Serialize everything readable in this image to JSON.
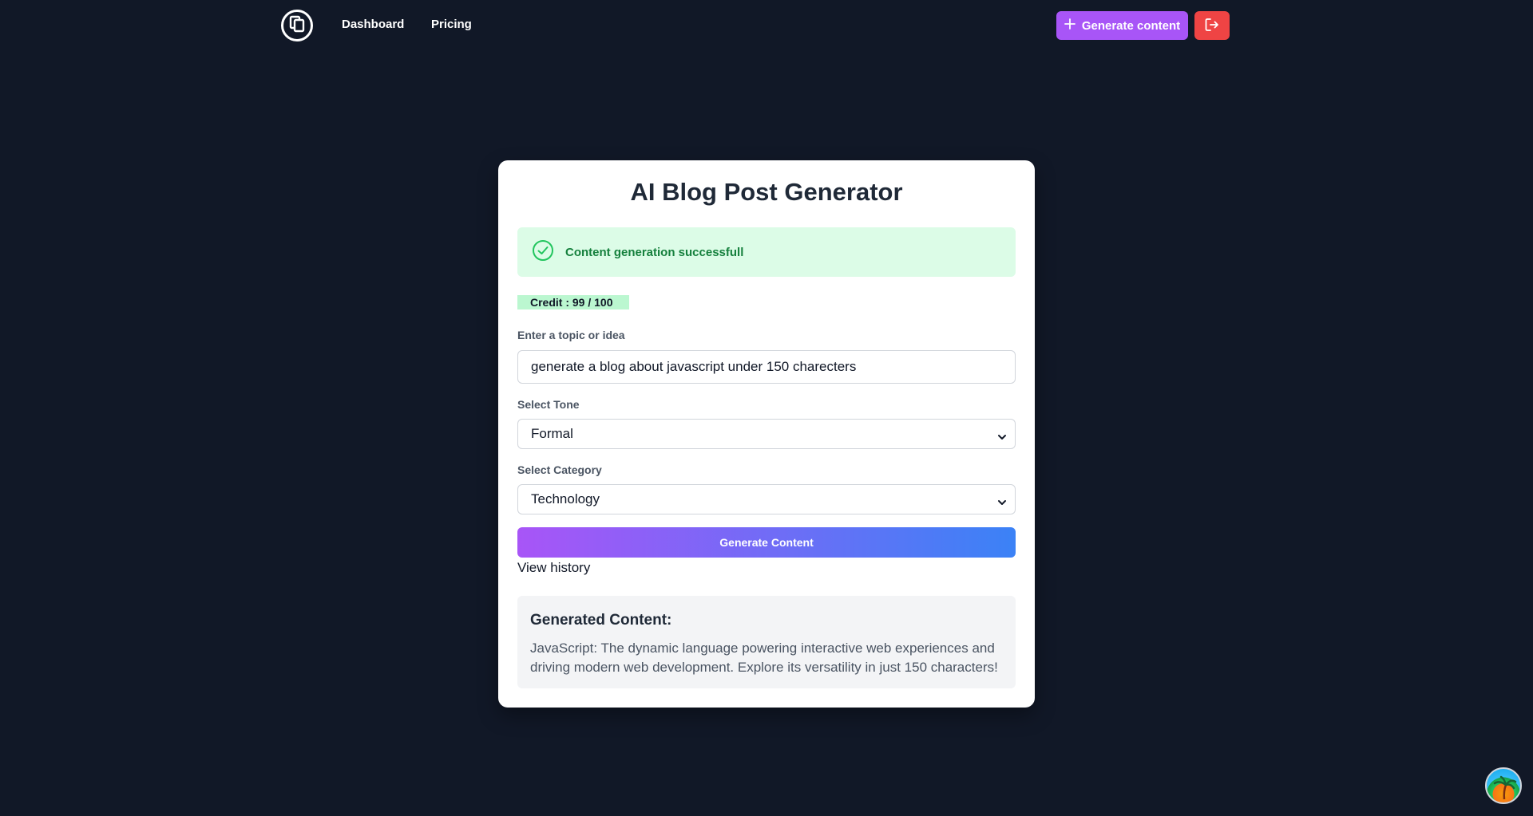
{
  "nav": {
    "logo_icon": "copy-pages-icon",
    "links": [
      {
        "label": "Dashboard"
      },
      {
        "label": "Pricing"
      }
    ],
    "generate_button": {
      "label": "Generate content",
      "icon": "plus-icon"
    },
    "logout_icon": "logout-icon"
  },
  "card": {
    "title": "AI Blog Post Generator",
    "alert": {
      "icon": "check-circle-icon",
      "text": "Content generation successfull"
    },
    "credit": "Credit : 99 / 100",
    "topic": {
      "label": "Enter a topic or idea",
      "value": "generate a blog about javascript under 150 charecters"
    },
    "tone": {
      "label": "Select Tone",
      "selected": "Formal"
    },
    "category": {
      "label": "Select Category",
      "selected": "Technology"
    },
    "submit_label": "Generate Content",
    "history_link": "View history",
    "result": {
      "title": "Generated Content:",
      "text": "JavaScript: The dynamic language powering interactive web experiences and driving modern web development. Explore its versatility in just 150 characters!"
    }
  },
  "colors": {
    "background": "#111827",
    "accent_purple": "#a855f7",
    "accent_blue": "#3b82f6",
    "danger": "#ef4444",
    "success_bg": "#dcfce7",
    "success_text": "#15803d"
  }
}
